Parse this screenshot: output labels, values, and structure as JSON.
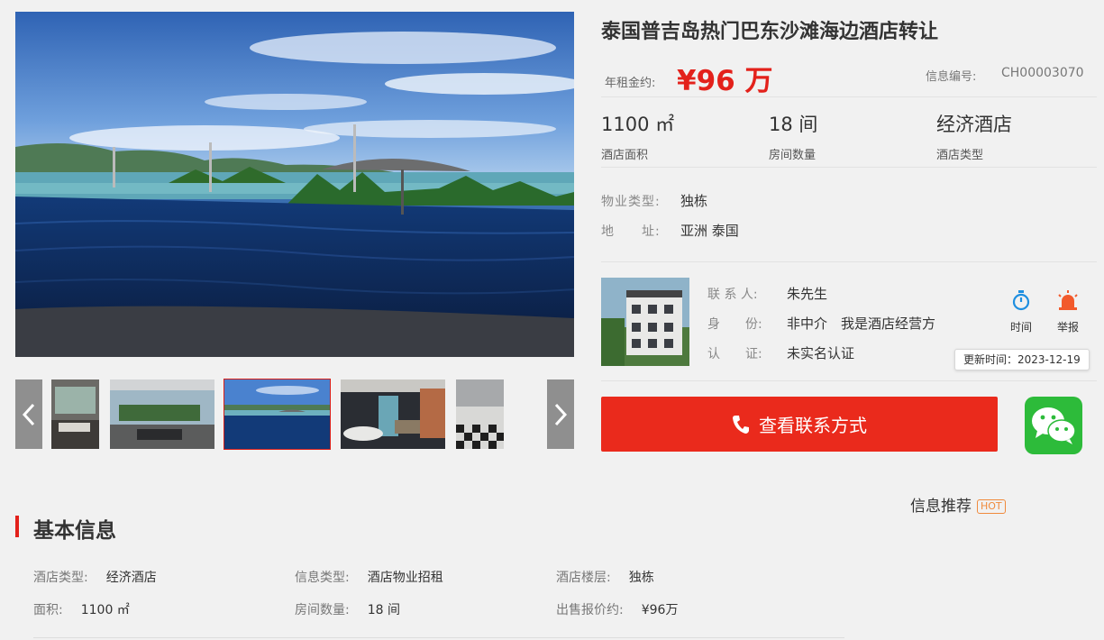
{
  "listing": {
    "title": "泰国普吉岛热门巴东沙滩海边酒店转让",
    "price_label": "年租金约:",
    "price_value": "¥96 万",
    "info_code_label": "信息编号:",
    "info_code_value": "CH00003070"
  },
  "stats": [
    {
      "value": "1100 ㎡",
      "label": "酒店面积"
    },
    {
      "value": "18 间",
      "label": "房间数量"
    },
    {
      "value": "经济酒店",
      "label": "酒店类型"
    }
  ],
  "attributes": [
    {
      "key": "物业类型:",
      "value": "独栋"
    },
    {
      "key": "地　　址:",
      "value": "亚洲 泰国"
    }
  ],
  "contact": {
    "rows": [
      {
        "key": "联 系 人:",
        "value": "朱先生"
      },
      {
        "key": "身　　份:",
        "value": "非中介　我是酒店经营方"
      },
      {
        "key": "认　　证:",
        "value": "未实名认证"
      }
    ],
    "time_label": "时间",
    "report_label": "举报",
    "update_tooltip": "更新时间：2023-12-19",
    "cta_label": "查看联系方式"
  },
  "recommend": {
    "label": "信息推荐",
    "badge": "HOT"
  },
  "basic_info": {
    "title": "基本信息",
    "items": [
      {
        "key": "酒店类型:",
        "value": "经济酒店"
      },
      {
        "key": "信息类型:",
        "value": "酒店物业招租"
      },
      {
        "key": "酒店楼层:",
        "value": "独栋"
      },
      {
        "key": "面积:",
        "value": "1100 ㎡"
      },
      {
        "key": "房间数量:",
        "value": "18 间"
      },
      {
        "key": "出售报价约:",
        "value": "¥96万"
      }
    ]
  },
  "thumbnails": [
    {
      "name": "lounge"
    },
    {
      "name": "terrace"
    },
    {
      "name": "pool",
      "active": true
    },
    {
      "name": "bathroom"
    },
    {
      "name": "lobby"
    }
  ],
  "colors": {
    "accent_red": "#e3211b",
    "cta_red": "#ea2a1c",
    "wechat_green": "#2dbb3a",
    "hot_orange": "#f08a3c",
    "icon_blue": "#1f8fe0",
    "icon_orange": "#f25a2c"
  }
}
